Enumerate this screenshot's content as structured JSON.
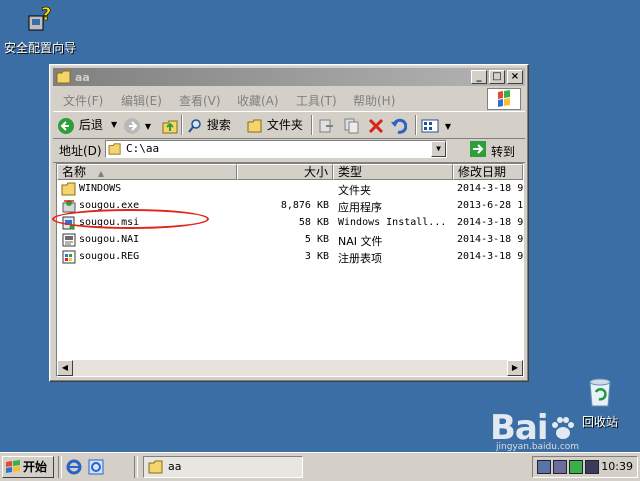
{
  "desktop": {
    "security_wizard_label": "安全配置向导",
    "recycle_bin_label": "回收站"
  },
  "window": {
    "title": "aa",
    "menu": [
      "文件(F)",
      "编辑(E)",
      "查看(V)",
      "收藏(A)",
      "工具(T)",
      "帮助(H)"
    ],
    "toolbar": {
      "back": "后退",
      "search": "搜索",
      "folders": "文件夹",
      "go": "转到"
    },
    "address": {
      "label": "地址(D)",
      "value": "C:\\aa"
    },
    "columns": [
      "名称",
      "大小",
      "类型",
      "修改日期"
    ],
    "files": [
      {
        "name": "WINDOWS",
        "size": "",
        "type": "文件夹",
        "date": "2014-3-18 9",
        "icon": "folder-icon"
      },
      {
        "name": "sougou.exe",
        "size": "8,876 KB",
        "type": "应用程序",
        "date": "2013-6-28 1",
        "icon": "exe-icon"
      },
      {
        "name": "sougou.msi",
        "size": "58 KB",
        "type": "Windows Install...",
        "date": "2014-3-18 9",
        "icon": "msi-icon"
      },
      {
        "name": "sougou.NAI",
        "size": "5 KB",
        "type": "NAI 文件",
        "date": "2014-3-18 9",
        "icon": "nai-icon"
      },
      {
        "name": "sougou.REG",
        "size": "3 KB",
        "type": "注册表项",
        "date": "2014-3-18 9",
        "icon": "reg-icon"
      }
    ]
  },
  "taskbar": {
    "start": "开始",
    "task": "aa",
    "clock": "10:39"
  },
  "watermark": {
    "brand": "Bai",
    "sub": "jingyan.baidu.com"
  }
}
